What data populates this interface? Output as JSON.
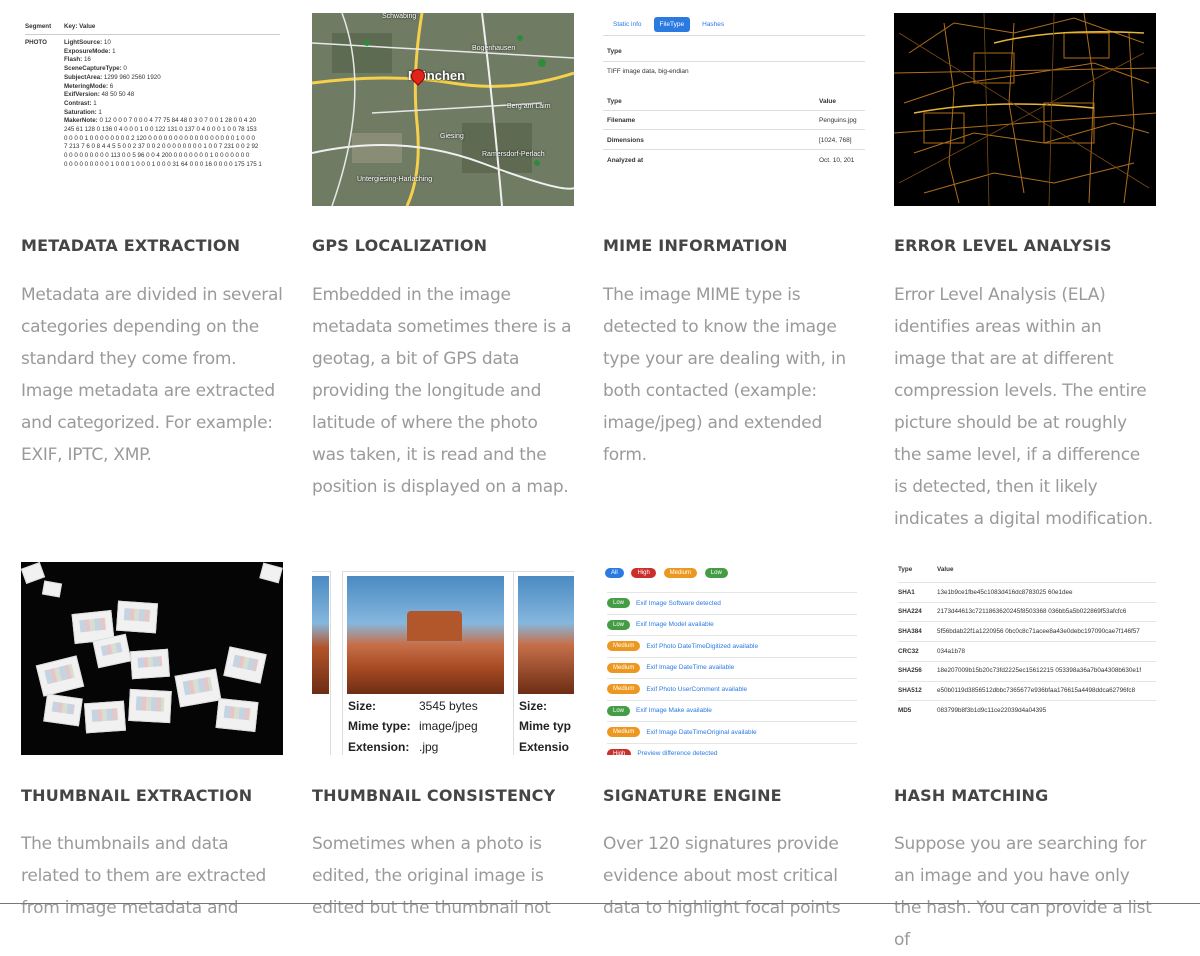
{
  "features": [
    {
      "title": "METADATA EXTRACTION",
      "description": "Metadata are divided in several categories depending on the standard they come from. Image metadata are extracted and categorized. For example: EXIF, IPTC, XMP."
    },
    {
      "title": "GPS LOCALIZATION",
      "description": "Embedded in the image metadata sometimes there is a geotag, a bit of GPS data providing the longitude and latitude of where the photo was taken, it is read and the position is displayed on a map."
    },
    {
      "title": "MIME INFORMATION",
      "description": "The image MIME type is detected to know the image type your are dealing with, in both contacted (example: image/jpeg) and extended form."
    },
    {
      "title": "ERROR LEVEL ANALYSIS",
      "description": "Error Level Analysis (ELA) identifies areas within an image that are at different compression levels. The entire picture should be at roughly the same level, if a difference is detected, then it likely indicates a digital modification."
    },
    {
      "title": "THUMBNAIL EXTRACTION",
      "description": "The thumbnails and data related to them are extracted from image metadata and"
    },
    {
      "title": "THUMBNAIL CONSISTENCY",
      "description": "Sometimes when a photo is edited, the original image is edited but the thumbnail not"
    },
    {
      "title": "SIGNATURE ENGINE",
      "description": "Over 120 signatures provide evidence about most critical data to highlight focal points"
    },
    {
      "title": "HASH MATCHING",
      "description": "Suppose you are searching for an image and you have only the hash. You can provide a list of"
    }
  ],
  "metadata_preview": {
    "headers": [
      "Segment",
      "Key: Value"
    ],
    "segment": "PHOTO",
    "rows": [
      {
        "key": "LightSource:",
        "value": "10"
      },
      {
        "key": "ExposureMode:",
        "value": "1"
      },
      {
        "key": "Flash:",
        "value": "16"
      },
      {
        "key": "SceneCaptureType:",
        "value": "0"
      },
      {
        "key": "SubjectArea:",
        "value": "1299 960 2560 1920"
      },
      {
        "key": "MeteringMode:",
        "value": "6"
      },
      {
        "key": "ExifVersion:",
        "value": "48 50 50 48"
      },
      {
        "key": "Contrast:",
        "value": "1"
      },
      {
        "key": "Saturation:",
        "value": "1"
      },
      {
        "key": "MakerNote:",
        "value": "0 12 0 0 0 7 0 0 0 4 77 75 84 48 0 3 0 7 0 0 1 28 0 0 4 20"
      }
    ],
    "makernote_cont": [
      "245 61 128 0 136 0 4 0 0 0 1 0 0 122 131 0 137 0 4 0 0 0 1 0 0 78 153",
      "0 0 0 0 1 0 0 0 0 0 0 0 0 2 120 0 0 0 0 0 0 0 0 0 0 0 0 0 0 0 0 0 1 0 0 0",
      "7 213 7 6 0 8 4 4 5 5 0 0 2 37 0 0 2 0 0 0 0 0 0 0 0 1 0 0 7 231 0 0 2 92",
      "0 0 0 0 0 0 0 0 0 113 0 0 5 96 0 0 4 200 0 0 0 0 0 0 0 1 0 0 0 0 0 0 0",
      "0 0 0 0 0 0 0 0 0 1 0 0 0 1 0 0 0 1 0 0 0 31 64 0 0 0 16 0 0 0 0 175 175 1"
    ]
  },
  "map_preview": {
    "city": "München",
    "labels": [
      "Schwabing",
      "Bogenhausen",
      "Giesing",
      "Untergiesing-Harlaching",
      "Berg am Laim",
      "Ramersdorf-Perlach"
    ]
  },
  "mime_preview": {
    "tabs": [
      "Static info",
      "FileType",
      "Hashes"
    ],
    "type_heading": "Type",
    "type_value": "TIFF image data, big-endian",
    "table_headers": [
      "Type",
      "Value"
    ],
    "rows": [
      {
        "key": "Filename",
        "value": "Penguins.jpg"
      },
      {
        "key": "Dimensions",
        "value": "[1024, 768]"
      },
      {
        "key": "Analyzed at",
        "value": "Oct. 10, 201"
      }
    ]
  },
  "consistency_preview": {
    "size_label": "Size:",
    "size_value": "3545 bytes",
    "mime_label": "Mime type:",
    "mime_value": "image/jpeg",
    "ext_label": "Extension:",
    "ext_value": ".jpg",
    "right_size_label": "Size:",
    "right_mime_label": "Mime typ",
    "right_ext_label": "Extensio"
  },
  "signature_preview": {
    "filters": [
      {
        "label": "All",
        "color": "#2a7ae2"
      },
      {
        "label": "High",
        "color": "#c9302c"
      },
      {
        "label": "Medium",
        "color": "#ec971f"
      },
      {
        "label": "Low",
        "color": "#449d44"
      }
    ],
    "items": [
      {
        "level": "Low",
        "text": "Exif Image Software detected"
      },
      {
        "level": "Low",
        "text": "Exif Image Model available"
      },
      {
        "level": "Medium",
        "text": "Exif Photo DateTimeDigitized available"
      },
      {
        "level": "Medium",
        "text": "Exif Image DateTime available"
      },
      {
        "level": "Medium",
        "text": "Exif Photo UserComment available"
      },
      {
        "level": "Low",
        "text": "Exif Image Make available"
      },
      {
        "level": "Medium",
        "text": "Exif Image DateTimeOriginal available"
      },
      {
        "level": "High",
        "text": "Preview difference detected"
      }
    ]
  },
  "hash_preview": {
    "headers": [
      "Type",
      "Value"
    ],
    "rows": [
      {
        "type": "SHA1",
        "value": "13e1b9ce1fbe45c1083d416dc8783025 60e1dee"
      },
      {
        "type": "SHA224",
        "value": "2173d44613c7211863620245f8503368 036bb5a5b022869f53afcfc6"
      },
      {
        "type": "SHA384",
        "value": "5f56bdab22f1a1220956 0bc0c8c71acee8a43e0debc197090cae7f146f57"
      },
      {
        "type": "CRC32",
        "value": "034a1b78"
      },
      {
        "type": "SHA256",
        "value": "18e207009b15b20c73fd2225ec15612215 053398a36a7b0a4308b630e1f"
      },
      {
        "type": "SHA512",
        "value": "e50b0119d3856512dbbc7365677e936bfaa176615a4498ddca62796fc8"
      },
      {
        "type": "MD5",
        "value": "083799b8f3b1d9c11ce22039d4a04395"
      }
    ]
  }
}
